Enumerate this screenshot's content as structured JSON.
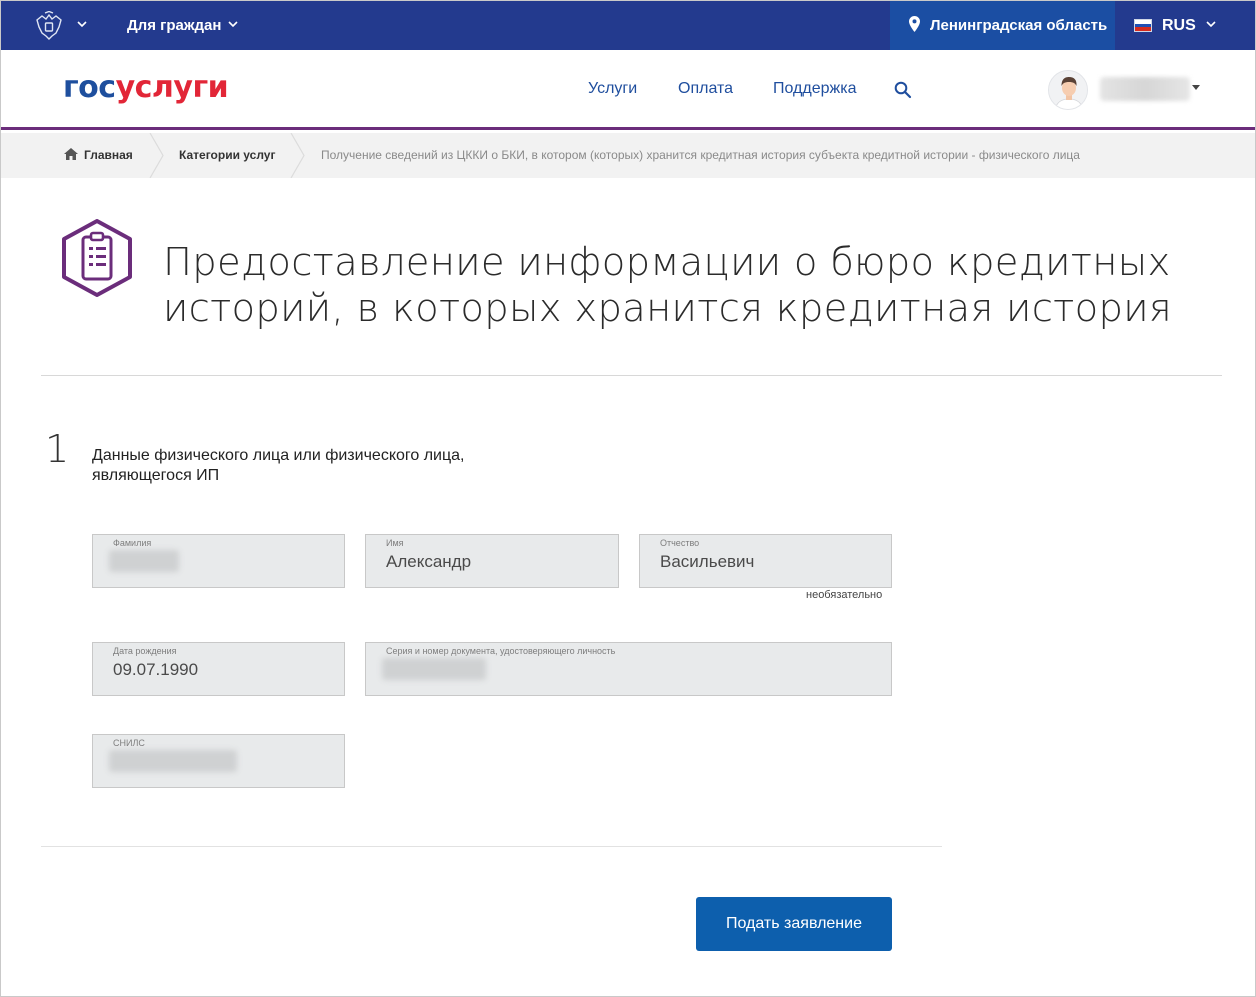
{
  "topbar": {
    "citizens_label": "Для граждан",
    "region_label": "Ленинградская область",
    "lang_label": "RUS",
    "colors": {
      "bar": "#233a8e",
      "region_bg": "#1b4ea3"
    }
  },
  "header": {
    "logo_part1": "гос",
    "logo_part2": "услуги",
    "nav": [
      "Услуги",
      "Оплата",
      "Поддержка"
    ],
    "accent_line": "#6b2d7b"
  },
  "breadcrumbs": {
    "home": "Главная",
    "category": "Категории услуг",
    "current": "Получение сведений из ЦККИ о БКИ, в котором (которых) хранится кредитная история субъекта кредитной истории - физического лица"
  },
  "page": {
    "title_line1": "Предоставление информации о бюро кредитных",
    "title_line2": "историй, в которых хранится кредитная история",
    "step_number": "1",
    "step_title_line1": "Данные физического лица или физического лица,",
    "step_title_line2": "являющегося ИП"
  },
  "form": {
    "surname": {
      "label": "Фамилия",
      "value": ""
    },
    "name": {
      "label": "Имя",
      "value": "Александр"
    },
    "patronymic": {
      "label": "Отчество",
      "value": "Васильевич",
      "note": "необязательно"
    },
    "birthdate": {
      "label": "Дата рождения",
      "value": "09.07.1990"
    },
    "document": {
      "label": "Серия и номер документа, удостоверяющего личность",
      "value": ""
    },
    "snils": {
      "label": "СНИЛС",
      "value": ""
    },
    "submit_label": "Подать заявление"
  }
}
